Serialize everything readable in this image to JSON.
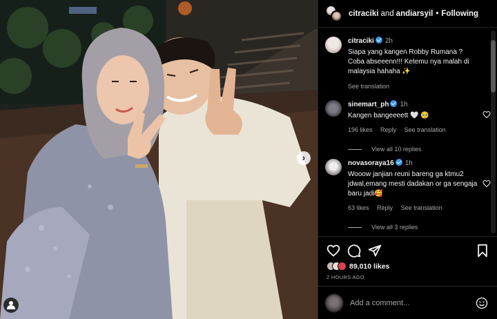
{
  "post": {
    "header": {
      "user1": "citraciki",
      "joiner": "and",
      "user2": "andiarsyil",
      "dot": "•",
      "follow_label": "Following"
    },
    "caption": {
      "username": "citraciki",
      "time": "2h",
      "text": "Siapa yang kangen Robby Rumana ? Coba abseeenn!!! Ketemu nya malah di malaysia hahaha ✨",
      "see_translation": "See translation"
    },
    "comments": [
      {
        "username": "sinemart_ph",
        "time": "1h",
        "text": "Kangen bangeeeett 🤍 🥺",
        "likes": "196 likes",
        "reply": "Reply",
        "see_translation": "See translation",
        "view_replies": "View all 10 replies"
      },
      {
        "username": "novasoraya16",
        "time": "1h",
        "text": "Wooow janjian reuni bareng ga ktmu2 jdwal,emang mesti dadakan or ga sengaja baru jadi🥰",
        "likes": "63 likes",
        "reply": "Reply",
        "see_translation": "See translation",
        "view_replies": "View all 3 replies"
      }
    ],
    "likes_count": "89,010 likes",
    "date": "2 HOURS AGO",
    "add_comment_placeholder": "Add a comment...",
    "photo_next_icon": "›",
    "colors": {
      "verified": "#3897f0",
      "like_red": "#ed4956",
      "secondary_text": "#a8a8a8"
    }
  }
}
